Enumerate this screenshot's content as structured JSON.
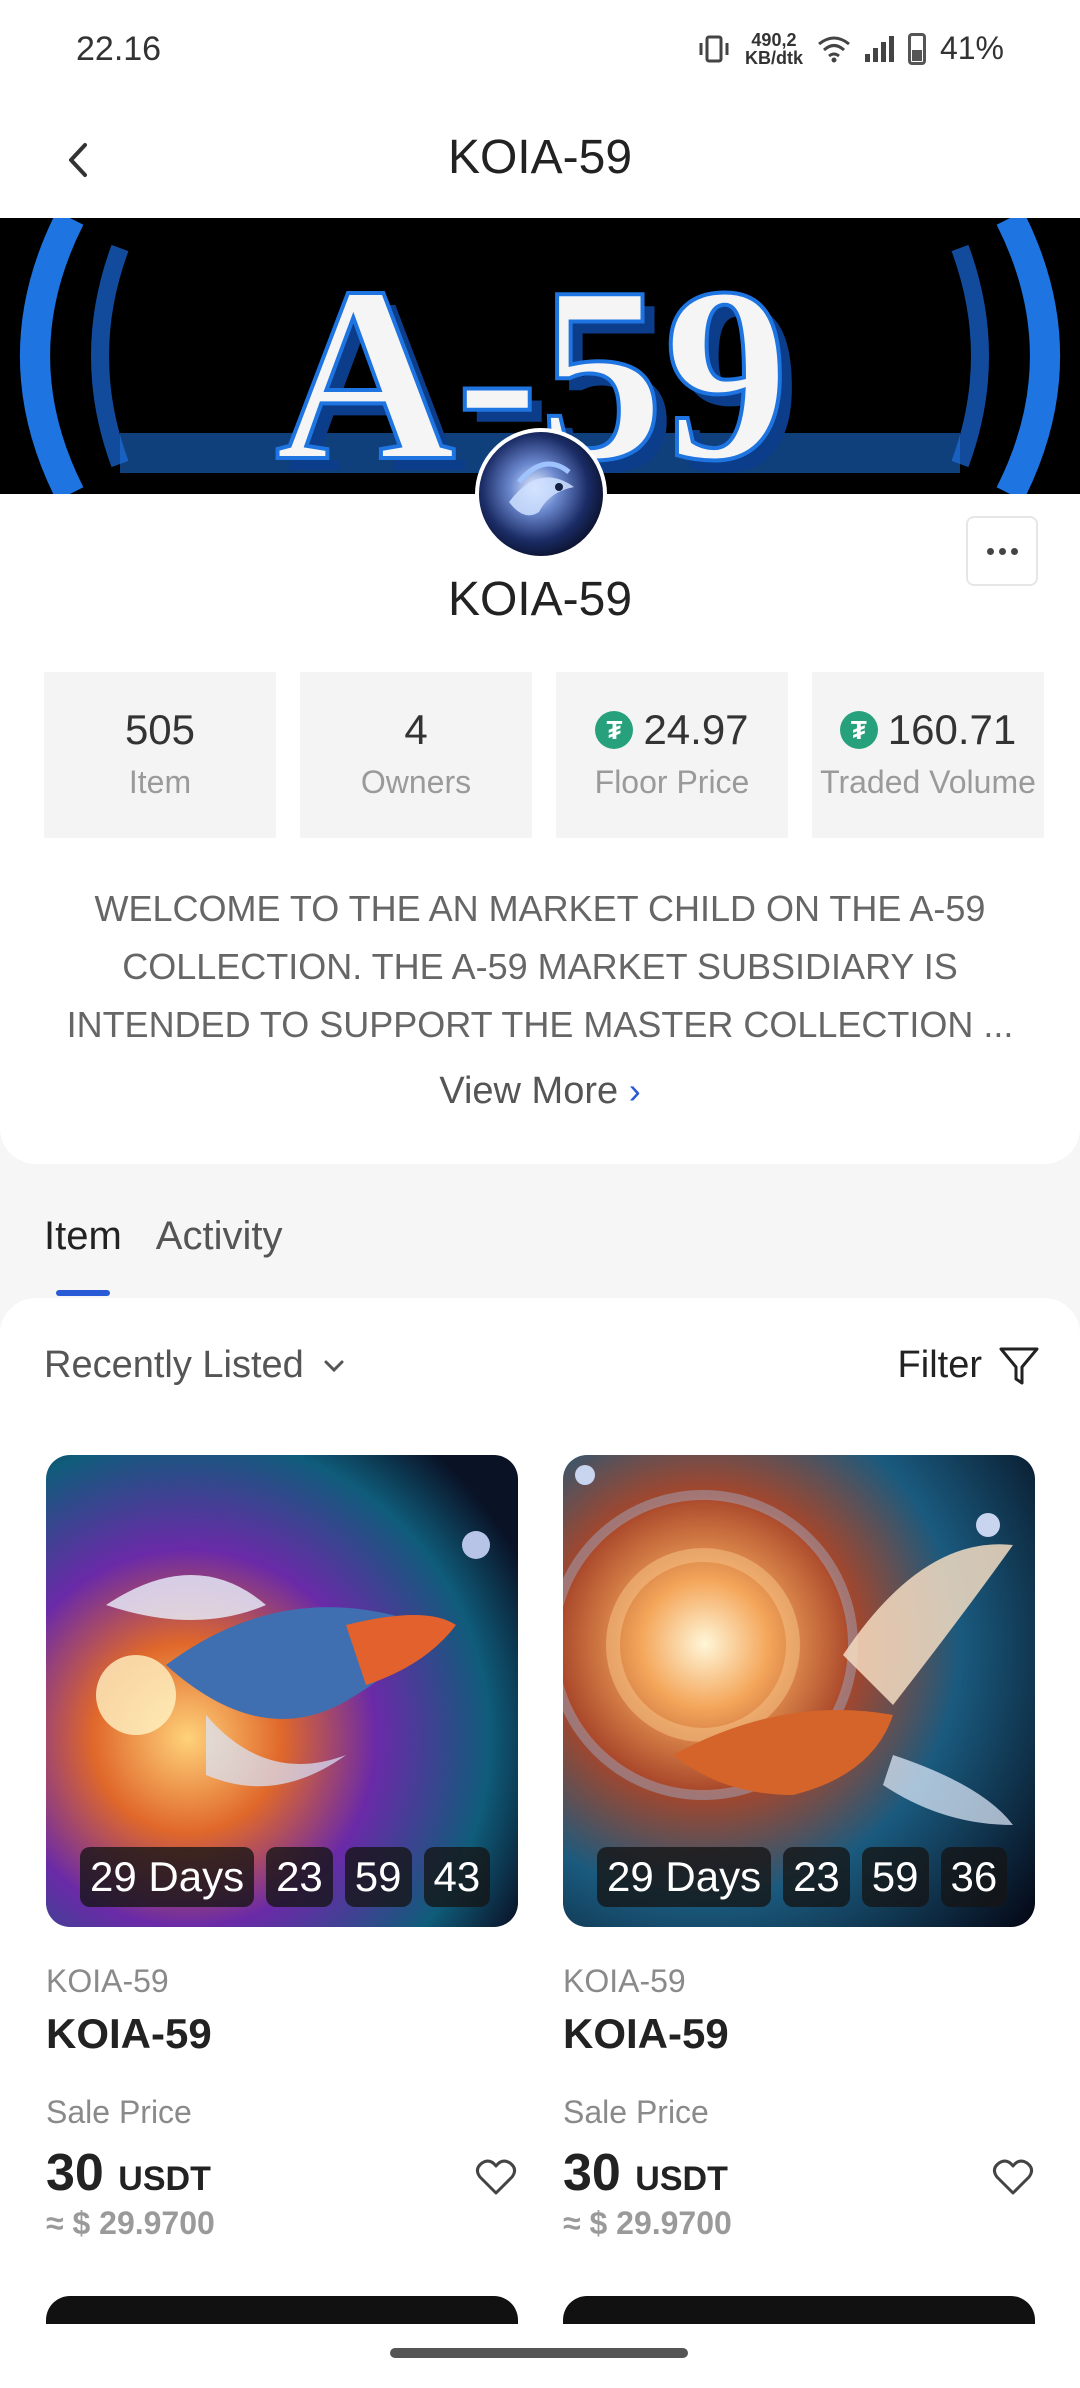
{
  "status": {
    "time": "22.16",
    "net_speed_value": "490,2",
    "net_speed_unit": "KB/dtk",
    "battery": "41%"
  },
  "header": {
    "title": "KOIA-59",
    "back_icon": "chevron-left-icon"
  },
  "banner": {
    "text": "A-59"
  },
  "collection": {
    "name": "KOIA-59",
    "more_icon": "more-horizontal-icon"
  },
  "stats": [
    {
      "value": "505",
      "label": "Item",
      "icon": ""
    },
    {
      "value": "4",
      "label": "Owners",
      "icon": ""
    },
    {
      "value": "24.97",
      "label": "Floor Price",
      "icon": "usdt-icon"
    },
    {
      "value": "160.71",
      "label": "Traded Volume",
      "icon": "usdt-icon"
    }
  ],
  "description": "WELCOME TO THE AN MARKET CHILD ON THE A-59 COLLECTION. THE A-59 MARKET SUBSIDIARY IS INTENDED TO SUPPORT THE MASTER COLLECTION ...",
  "view_more": "View More",
  "tabs": [
    {
      "label": "Item",
      "active": true
    },
    {
      "label": "Activity",
      "active": false
    }
  ],
  "sort": {
    "label": "Recently Listed"
  },
  "filter": {
    "label": "Filter"
  },
  "items": [
    {
      "collection": "KOIA-59",
      "name": "KOIA-59",
      "timer": {
        "days": "29 Days",
        "hours": "23",
        "minutes": "59",
        "seconds": "43"
      },
      "sale_label": "Sale Price",
      "price": "30",
      "currency": "USDT",
      "approx": "≈ $ 29.9700"
    },
    {
      "collection": "KOIA-59",
      "name": "KOIA-59",
      "timer": {
        "days": "29 Days",
        "hours": "23",
        "minutes": "59",
        "seconds": "36"
      },
      "sale_label": "Sale Price",
      "price": "30",
      "currency": "USDT",
      "approx": "≈ $ 29.9700"
    }
  ],
  "colors": {
    "accent": "#2a5bd7",
    "usdt": "#26a17b"
  }
}
